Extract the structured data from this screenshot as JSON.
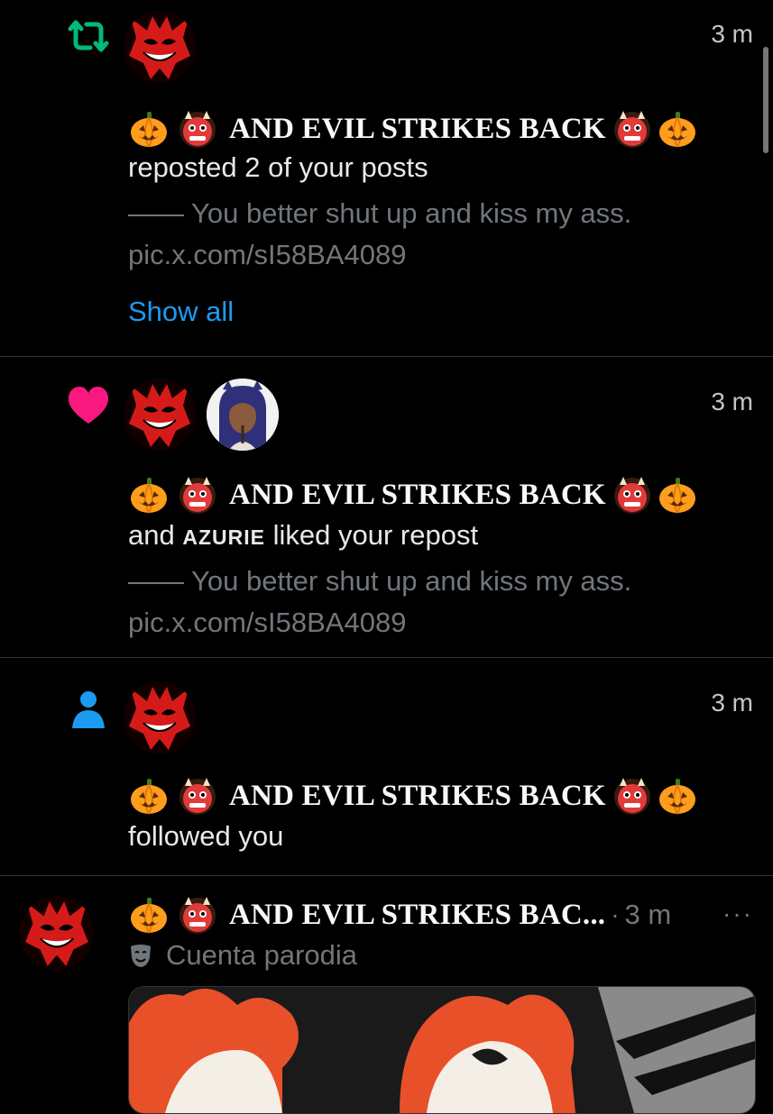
{
  "colors": {
    "background": "#000000",
    "divider": "#2f3336",
    "repost_green": "#00ba7c",
    "like_pink": "#f91880",
    "follow_blue": "#1d9bf0",
    "link_blue": "#1d9bf0",
    "muted_text": "#71767b"
  },
  "notifications": [
    {
      "type_icon": "repost-icon",
      "time": "3 m",
      "display_name": "AND EVIL STRIKES BACK",
      "action_text": "reposted 2 of your posts",
      "quote_line": "—— You better shut up and kiss my ass.",
      "quote_link": "pic.x.com/sI58BA4089",
      "show_all": "Show all"
    },
    {
      "type_icon": "heart-icon",
      "time": "3 m",
      "display_name": "AND EVIL STRIKES BACK",
      "action_prefix": "and",
      "other_user": "AZURIE",
      "action_suffix": "liked your repost",
      "quote_line": "—— You better shut up and kiss my ass.",
      "quote_link": "pic.x.com/sI58BA4089"
    },
    {
      "type_icon": "person-icon",
      "time": "3 m",
      "display_name": "AND EVIL STRIKES BACK",
      "action_text": "followed you"
    }
  ],
  "post": {
    "display_name": "AND EVIL STRIKES BAC...",
    "separator": "·",
    "time": "3 m",
    "more": "···",
    "label": "Cuenta parodia"
  }
}
